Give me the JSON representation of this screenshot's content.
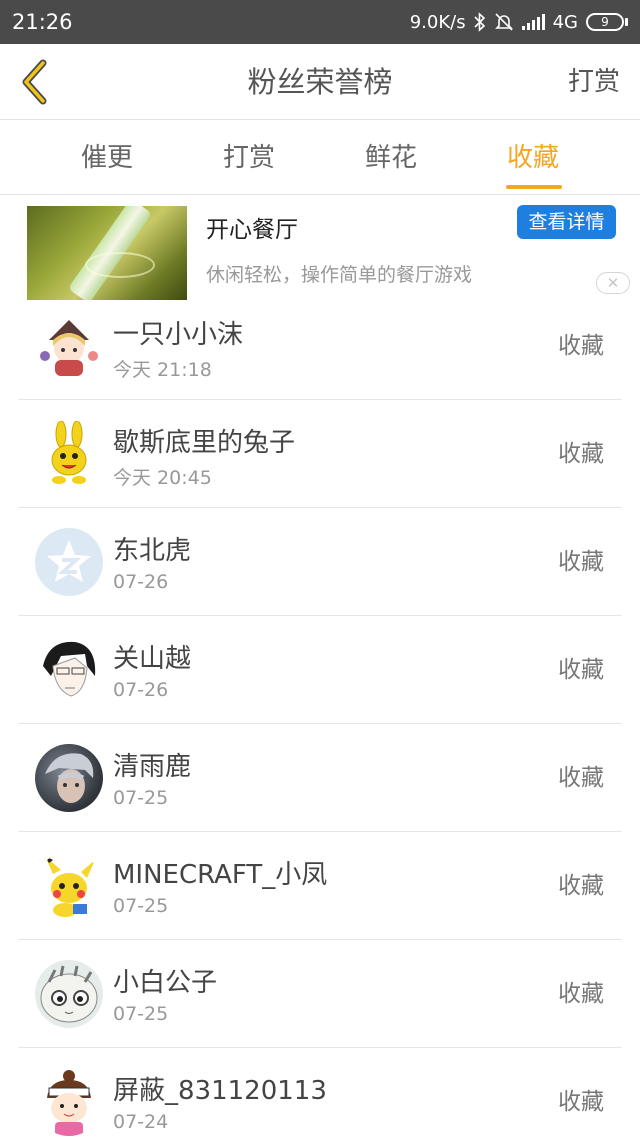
{
  "status_bar": {
    "time": "21:26",
    "net_speed": "9.0K/s",
    "network": "4G",
    "battery": "9"
  },
  "nav": {
    "title": "粉丝荣誉榜",
    "right_label": "打赏"
  },
  "tabs": [
    {
      "label": "催更",
      "active": false
    },
    {
      "label": "打赏",
      "active": false
    },
    {
      "label": "鲜花",
      "active": false
    },
    {
      "label": "收藏",
      "active": true
    }
  ],
  "ad": {
    "title": "开心餐厅",
    "description": "休闲轻松，操作简单的餐厅游戏",
    "button_label": "查看详情",
    "close_symbol": "✕"
  },
  "fans": [
    {
      "name": "一只小小沫",
      "time": "今天 21:18",
      "action": "收藏",
      "avatar": "anime-girl-avatar"
    },
    {
      "name": "歇斯底里的兔子",
      "time": "今天 20:45",
      "action": "收藏",
      "avatar": "yellow-rabbit-avatar"
    },
    {
      "name": "东北虎",
      "time": "07-26",
      "action": "收藏",
      "avatar": "default-z-avatar"
    },
    {
      "name": "关山越",
      "time": "07-26",
      "action": "收藏",
      "avatar": "manga-boy-avatar"
    },
    {
      "name": "清雨鹿",
      "time": "07-25",
      "action": "收藏",
      "avatar": "photo-avatar"
    },
    {
      "name": "MINECRAFT_小凤",
      "time": "07-25",
      "action": "收藏",
      "avatar": "pikachu-avatar"
    },
    {
      "name": "小白公子",
      "time": "07-25",
      "action": "收藏",
      "avatar": "cat-avatar"
    },
    {
      "name": "屏蔽_831120113",
      "time": "07-24",
      "action": "收藏",
      "avatar": "cartoon-girl-avatar"
    }
  ],
  "colors": {
    "accent": "#f5a623",
    "ad_button": "#1e7fe0",
    "status_bar": "#4a4a4a"
  }
}
